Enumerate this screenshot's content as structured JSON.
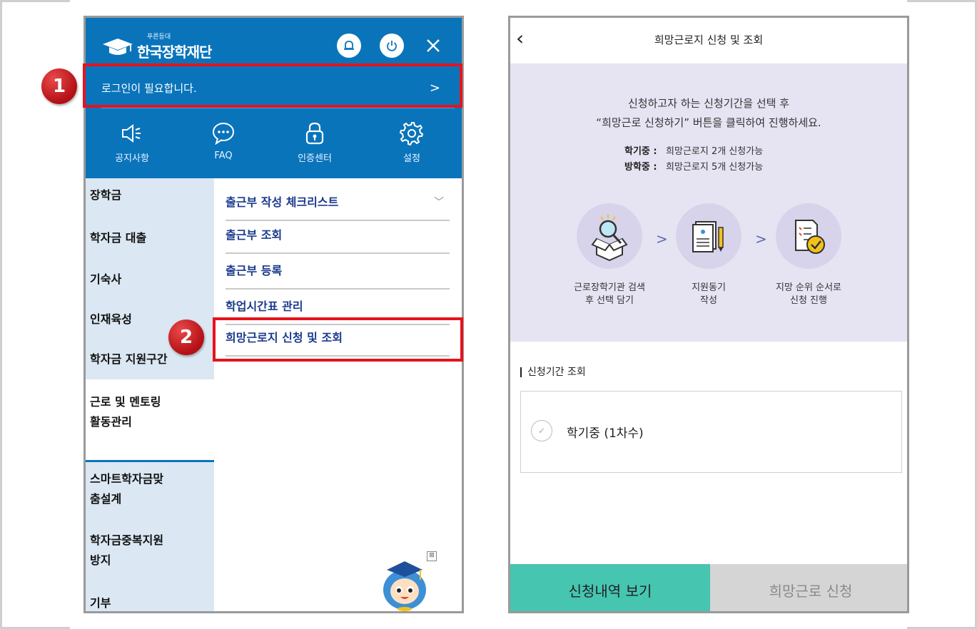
{
  "left_screen": {
    "logo": {
      "subtitle": "푸른등대",
      "title": "한국장학재단"
    },
    "login": {
      "text": "로그인이 필요합니다.",
      "chevron": ">"
    },
    "quick_menu": [
      {
        "icon": "megaphone-icon",
        "label": "공지사항"
      },
      {
        "icon": "chat-bubble-icon",
        "label": "FAQ"
      },
      {
        "icon": "lock-icon",
        "label": "인증센터"
      },
      {
        "icon": "gear-icon",
        "label": "설정"
      }
    ],
    "main_menu": [
      {
        "label": "장학금"
      },
      {
        "label": "학자금 대출"
      },
      {
        "label": "기숙사"
      },
      {
        "label": "인재육성"
      },
      {
        "label": "학자금 지원구간"
      },
      {
        "label": "근로 및 멘토링\n활동관리"
      },
      {
        "label": "스마트학자금맞\n춤설계"
      },
      {
        "label": "학자금중복지원\n방지"
      },
      {
        "label": "기부"
      }
    ],
    "sub_menu": [
      {
        "label": "출근부 작성 체크리스트"
      },
      {
        "label": "출근부 조회"
      },
      {
        "label": "출근부 등록"
      },
      {
        "label": "학업시간표 관리"
      },
      {
        "label": "희망근로지 신청 및 조회"
      }
    ],
    "callouts": [
      "1",
      "2"
    ],
    "ad_close": "⊠"
  },
  "right_screen": {
    "header": {
      "back": "‹",
      "title": "희망근로지 신청 및 조회"
    },
    "info": {
      "line1": "신청하고자 하는 신청기간을 선택 후",
      "line2": "“희망근로 신청하기” 버튼을 클릭하여 진행하세요.",
      "term1_label": "학기중 :",
      "term1_value": "희망근로지 2개 신청가능",
      "term2_label": "방학중 :",
      "term2_value": "희망근로지 5개 신청가능",
      "steps": [
        {
          "icon": "search-box-icon",
          "label": "근로장학기관 검색\n후 선택 담기"
        },
        {
          "icon": "document-pencil-icon",
          "label": "지원동기\n작성"
        },
        {
          "icon": "checklist-icon",
          "label": "지망 순위 순서로\n신청 진행"
        }
      ],
      "arrow": ">"
    },
    "period": {
      "title": "신청기간 조회",
      "option_label": "학기중 (1차수)",
      "check": "✓"
    },
    "buttons": {
      "history": "신청내역 보기",
      "apply": "희망근로 신청"
    }
  },
  "colors": {
    "brand_blue": "#0a74bb",
    "callout_red": "#e5131c",
    "teal": "#46c5b0",
    "lavender": "#e6e4f3"
  }
}
